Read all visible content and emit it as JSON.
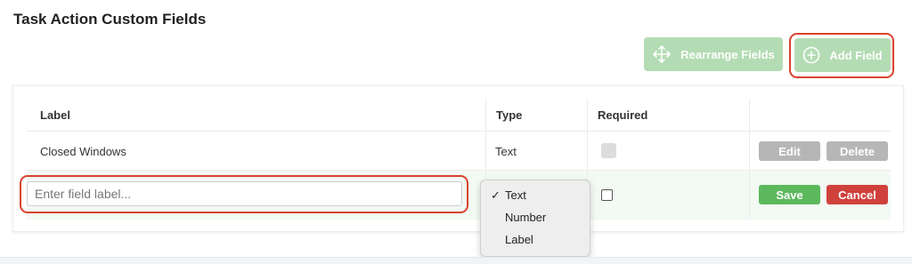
{
  "page": {
    "title": "Task Action Custom Fields"
  },
  "toolbar": {
    "rearrange_label": "Rearrange Fields",
    "add_label": "Add Field"
  },
  "table": {
    "headers": {
      "label": "Label",
      "type": "Type",
      "required": "Required"
    },
    "rows": [
      {
        "label": "Closed Windows",
        "type": "Text",
        "required": false
      }
    ],
    "actions": {
      "edit": "Edit",
      "delete": "Delete",
      "save": "Save",
      "cancel": "Cancel"
    }
  },
  "new_field": {
    "placeholder": "Enter field label...",
    "value": ""
  },
  "type_dropdown": {
    "options": [
      "Text",
      "Number",
      "Label"
    ],
    "selected": "Text",
    "check_mark": "✓"
  },
  "colors": {
    "button_green_disabled": "#b4dcb4",
    "save_green": "#5cb85c",
    "cancel_red": "#d0413c",
    "highlight_red": "#d9432c",
    "muted_gray": "#b6b6b6"
  }
}
